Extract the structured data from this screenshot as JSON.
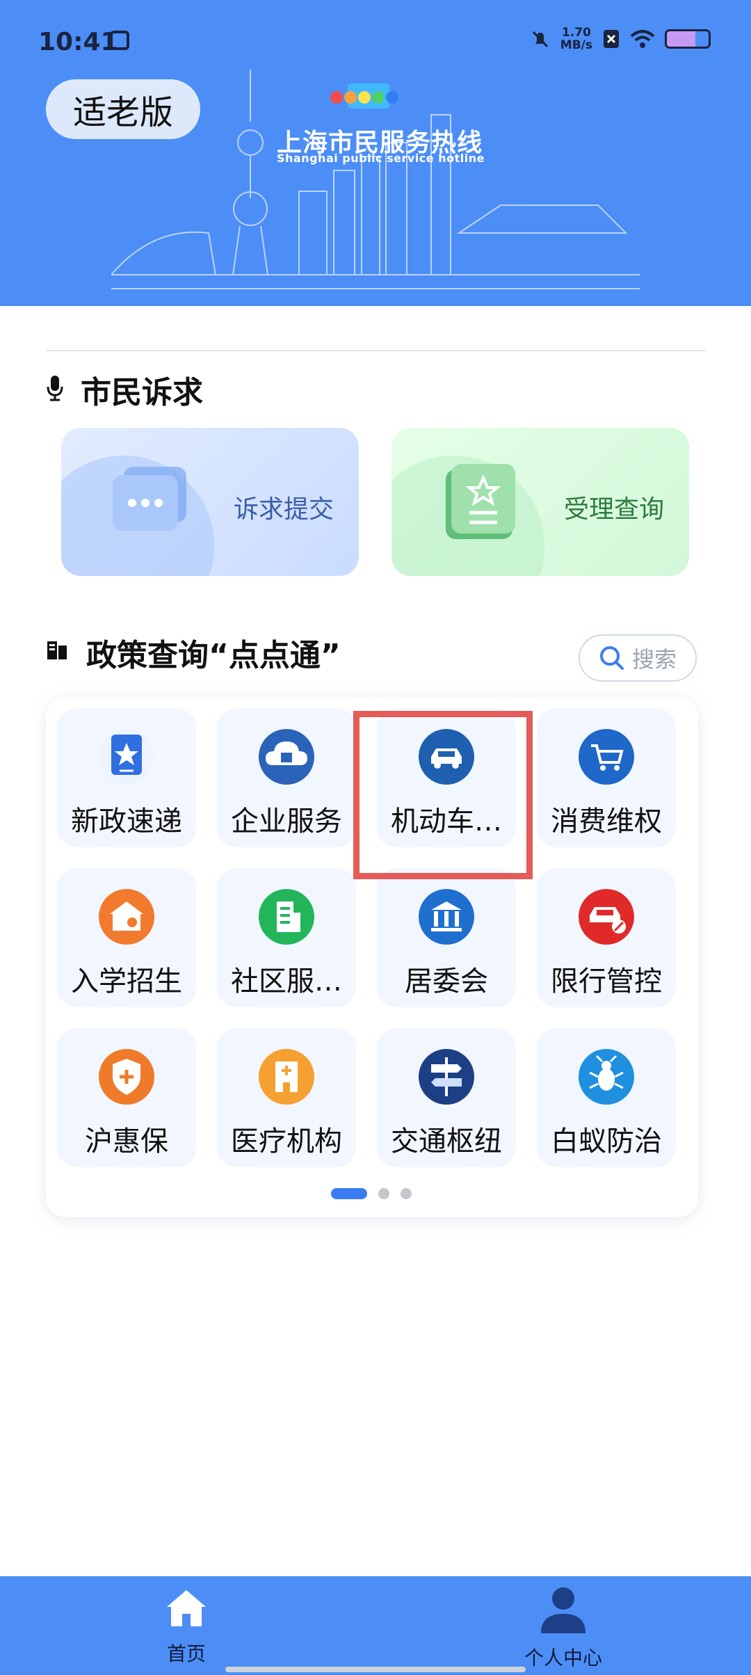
{
  "status_bar": {
    "time": "10:41",
    "speed_value": "1.70",
    "speed_unit": "MB/s"
  },
  "header": {
    "elder_mode_label": "适老版",
    "logo_digits": "12345",
    "title": "上海市民服务热线",
    "subtitle": "Shanghai public service hotline"
  },
  "citizen_section": {
    "title": "市民诉求",
    "cards": [
      {
        "label": "诉求提交",
        "icon": "chat-bubble-icon"
      },
      {
        "label": "受理查询",
        "icon": "star-document-icon"
      }
    ]
  },
  "policy_section": {
    "title": "政策查询“点点通”",
    "search_label": "搜索",
    "items": [
      {
        "label": "新政速递",
        "icon": "new-policy-icon",
        "color": "#2f6fe0"
      },
      {
        "label": "企业服务",
        "icon": "enterprise-cloud-icon",
        "color": "#2b63b8"
      },
      {
        "label": "机动车…",
        "icon": "car-icon",
        "color": "#1f5fb0"
      },
      {
        "label": "消费维权",
        "icon": "shopping-cart-icon",
        "color": "#1f67c8"
      },
      {
        "label": "入学招生",
        "icon": "school-enroll-icon",
        "color": "#f27a2e"
      },
      {
        "label": "社区服…",
        "icon": "community-building-icon",
        "color": "#22b55a"
      },
      {
        "label": "居委会",
        "icon": "neighborhood-committee-icon",
        "color": "#1f6fcf"
      },
      {
        "label": "限行管控",
        "icon": "restricted-car-icon",
        "color": "#e02a2a"
      },
      {
        "label": "沪惠保",
        "icon": "insurance-shield-icon",
        "color": "#ee7a2a"
      },
      {
        "label": "医疗机构",
        "icon": "hospital-icon",
        "color": "#f5a030"
      },
      {
        "label": "交通枢纽",
        "icon": "transport-hub-icon",
        "color": "#1d3f86"
      },
      {
        "label": "白蚁防治",
        "icon": "termite-control-icon",
        "color": "#1f8fe0"
      }
    ],
    "page_count": 3,
    "current_page": 1
  },
  "bottom_nav": {
    "items": [
      {
        "label": "首页",
        "icon": "home-icon"
      },
      {
        "label": "个人中心",
        "icon": "person-icon"
      }
    ]
  }
}
